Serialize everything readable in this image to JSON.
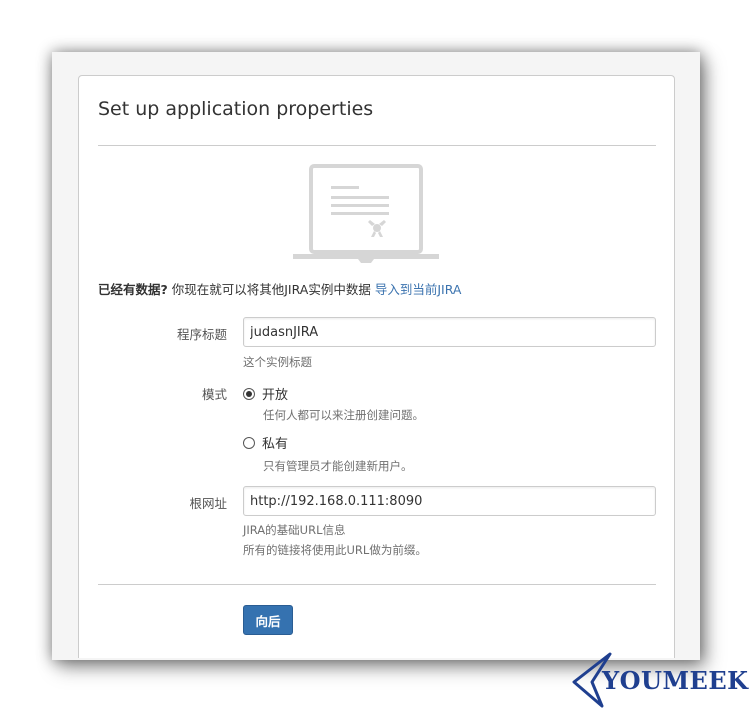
{
  "page": {
    "title": "Set up application properties"
  },
  "import_notice": {
    "bold_text": "已经有数据?",
    "text": " 你现在就可以将其他JIRA实例中数据 ",
    "link_text": "导入到当前JIRA"
  },
  "form": {
    "app_title": {
      "label": "程序标题",
      "value": "judasnJIRA",
      "help": "这个实例标题"
    },
    "mode": {
      "label": "模式",
      "options": [
        {
          "label": "开放",
          "description": "任何人都可以来注册创建问题。",
          "checked": true
        },
        {
          "label": "私有",
          "description": "只有管理员才能创建新用户。",
          "checked": false
        }
      ]
    },
    "base_url": {
      "label": "根网址",
      "value": "http://192.168.0.111:8090",
      "help_line1": "JIRA的基础URL信息",
      "help_line2": "所有的链接将使用此URL做为前缀。"
    },
    "next_button": "向后"
  },
  "watermark": {
    "text": "YOUMEEK"
  },
  "colors": {
    "link": "#3b73af",
    "primary_button": "#3572b0",
    "watermark": "#1f3f8f"
  }
}
